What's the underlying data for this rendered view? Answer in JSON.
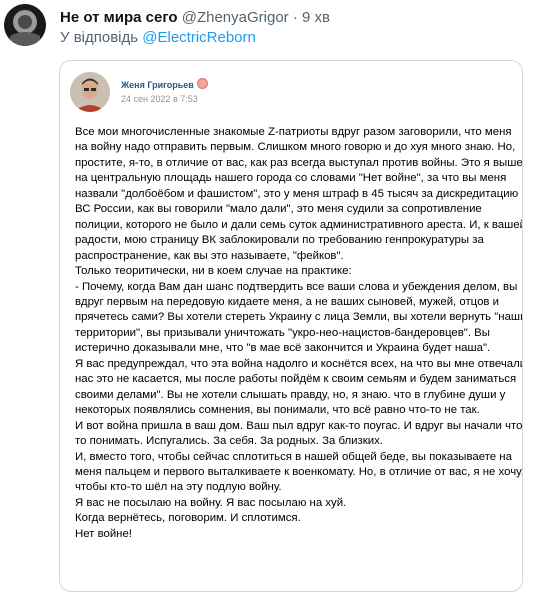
{
  "tweet": {
    "author_name": "Не от мира сего",
    "author_handle": "@ZhenyaGrigor",
    "separator": "·",
    "time": "9 хв",
    "reply_prefix": "У відповідь",
    "reply_to": "@ElectricReborn"
  },
  "vk_post": {
    "author": "Женя Григорьев",
    "date": "24 сен 2022 в 7:53",
    "lines": [
      "Все мои многочисленные знакомые Z-патриоты вдруг разом заговорили, что меня",
      "на войну надо отправить первым. Слишком много говорю и до хуя много знаю. Но,",
      "простите, я-то, в отличие от вас, как раз всегда выступал против войны. Это я вышел",
      "на центральную площадь нашего города со словами \"Нет войне\", за что вы меня",
      "назвали \"долбоёбом и фашистом\", это у меня штраф в 45 тысяч за дискредитацию",
      "ВС России, как вы говорили \"мало дали\", это меня судили за сопротивление",
      "полиции, которого не было и дали семь суток административного ареста. И, к вашей",
      "радости, мою страницу ВК заблокировали по требованию генпрокуратуры за",
      "распространение, как вы это называете, \"фейков\".",
      "Только теоритически, ни в коем случае на практике:",
      "- Почему, когда Вам дан шанс подтвердить все ваши слова и убеждения делом, вы",
      "вдруг первым на передовую кидаете меня, а не ваших сыновей, мужей, отцов и",
      "прячетесь сами? Вы хотели стереть Украину с лица Земли, вы хотели вернуть \"наши",
      "территории\", вы призывали уничтожать \"укро-нео-нацистов-бандеровцев\". Вы",
      "истерично доказывали мне, что \"в мае всё закончится и Украина будет наша\".",
      "Я вас предупреждал, что эта война надолго и коснётся всех, на что вы мне отвечали\"",
      "нас это не касается, мы после работы пойдём к своим семьям и будем заниматься",
      "своими делами\". Вы не хотели слышать правду, но, я знаю. что в глубине души у",
      "некоторых появлялись сомнения, вы понимали, что всё равно что-то не так.",
      "И вот война пришла в ваш дом. Ваш пыл вдруг как-то поугас. И вдруг вы начали что-",
      "то понимать. Испугались. За себя. За родных. За близких.",
      "И, вместо того, чтобы сейчас сплотиться в нашей общей беде, вы показываете на",
      "меня пальцем и первого выталкиваете к военкомату. Но, в отличие от вас, я не хочу,",
      "чтобы кто-то шёл на эту подлую войну.",
      "Я вас не посылаю на войну. Я вас посылаю на хуй.",
      "Когда вернётесь, поговорим. И сплотимся.",
      "Нет войне!"
    ]
  },
  "colors": {
    "link": "#1d9bf0",
    "vk_name": "#2a5885",
    "muted": "#536471"
  }
}
